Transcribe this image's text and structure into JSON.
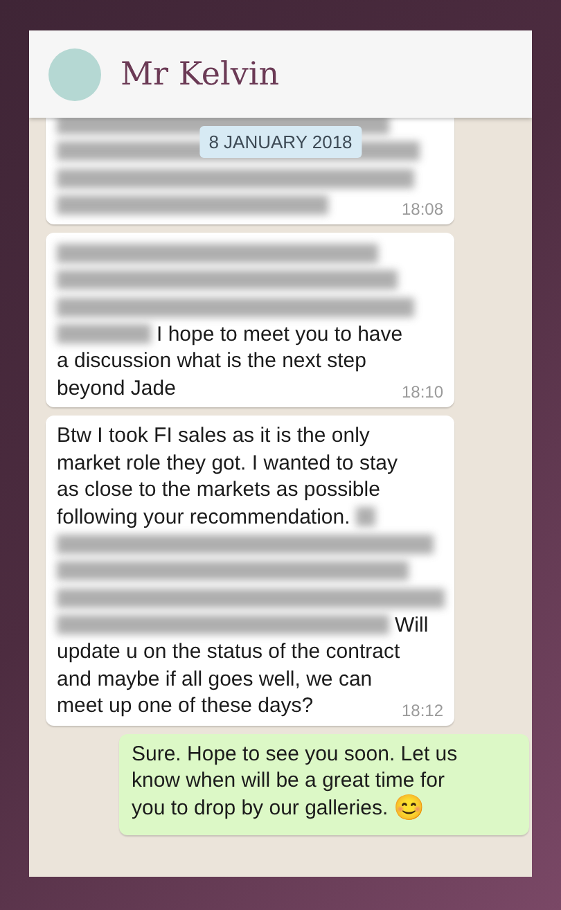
{
  "header": {
    "title": "Mr Kelvin"
  },
  "date_chip": "8 JANUARY 2018",
  "messages": [
    {
      "kind": "received",
      "time": "18:08",
      "lines": [
        [
          {
            "kind": "redacted"
          }
        ],
        [
          {
            "kind": "redacted"
          }
        ],
        [
          {
            "kind": "redacted"
          }
        ],
        [
          {
            "kind": "redacted"
          }
        ]
      ]
    },
    {
      "kind": "received",
      "time": "18:10",
      "lines": [
        [
          {
            "kind": "redacted"
          }
        ],
        [
          {
            "kind": "redacted"
          }
        ],
        [
          {
            "kind": "redacted"
          }
        ],
        [
          {
            "kind": "redacted"
          },
          {
            "kind": "text",
            "text": "I hope to meet you to have"
          }
        ],
        [
          {
            "kind": "text",
            "text": "a discussion what is the next step"
          }
        ],
        [
          {
            "kind": "text",
            "text": "beyond Jade"
          }
        ]
      ]
    },
    {
      "kind": "received",
      "time": "18:12",
      "lines": [
        [
          {
            "kind": "text",
            "text": "Btw I took FI sales as it is the only"
          }
        ],
        [
          {
            "kind": "text",
            "text": "market role they got. I wanted to stay"
          }
        ],
        [
          {
            "kind": "text",
            "text": "as close to the markets as possible"
          }
        ],
        [
          {
            "kind": "text",
            "text": "following your recommendation."
          },
          {
            "kind": "redacted"
          }
        ],
        [
          {
            "kind": "redacted"
          }
        ],
        [
          {
            "kind": "redacted"
          }
        ],
        [
          {
            "kind": "redacted"
          }
        ],
        [
          {
            "kind": "redacted"
          },
          {
            "kind": "text",
            "text": "Will"
          }
        ],
        [
          {
            "kind": "text",
            "text": "update u on the status of the contract"
          }
        ],
        [
          {
            "kind": "text",
            "text": "and maybe if all goes well, we can"
          }
        ],
        [
          {
            "kind": "text",
            "text": "meet up one of these days?"
          }
        ]
      ]
    },
    {
      "kind": "sent",
      "lines": [
        [
          {
            "kind": "text",
            "text": "Sure. Hope to see you soon. Let us"
          }
        ],
        [
          {
            "kind": "text",
            "text": "know when will be a great time for"
          }
        ],
        [
          {
            "kind": "text",
            "text": "you to drop by our galleries."
          },
          {
            "kind": "emoji",
            "text": "😊"
          }
        ]
      ]
    }
  ]
}
